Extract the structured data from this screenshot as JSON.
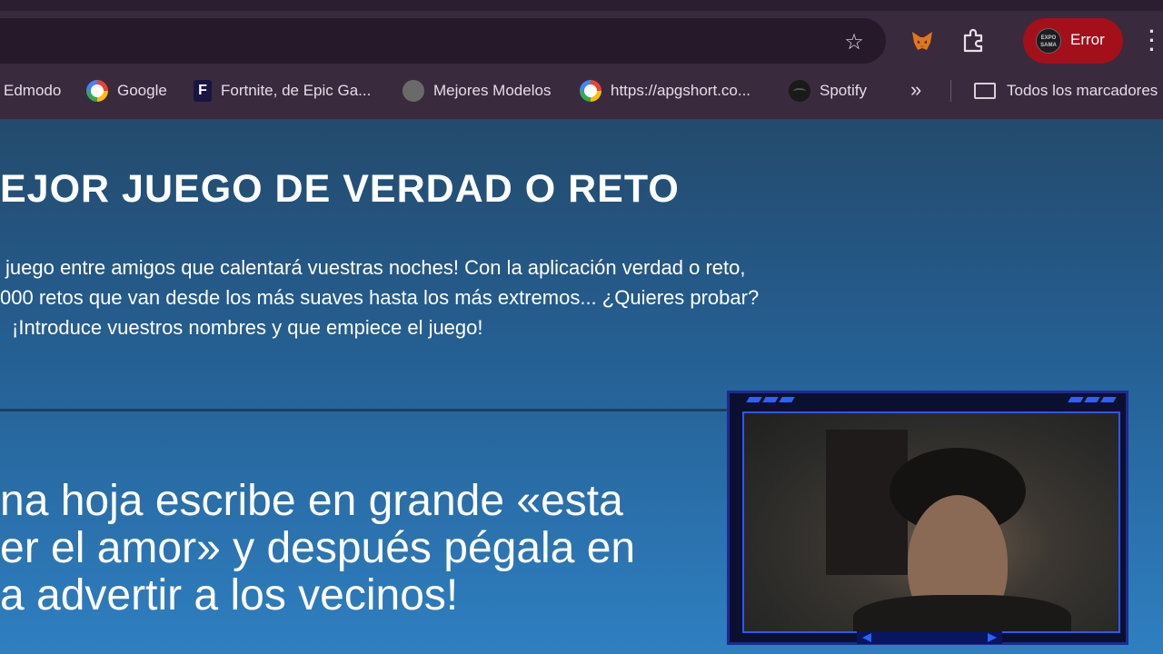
{
  "browser": {
    "profile_label": "Error",
    "avatar_text": "EXPO SAMA",
    "bookmarks": [
      {
        "label": "Edmodo",
        "icon": "edmodo-icon"
      },
      {
        "label": "Google",
        "icon": "google-icon"
      },
      {
        "label": "Fortnite, de Epic Ga...",
        "icon": "fortnite-icon"
      },
      {
        "label": "Mejores Modelos",
        "icon": "bear-icon"
      },
      {
        "label": "https://apgshort.co...",
        "icon": "google-icon"
      },
      {
        "label": "Spotify",
        "icon": "spotify-icon"
      }
    ],
    "more_bookmarks": "»",
    "all_bookmarks": "Todos los marcadores"
  },
  "page": {
    "title": "EJOR JUEGO DE VERDAD O RETO",
    "intro_lines": [
      "juego entre amigos que calentará vuestras noches! Con la aplicación verdad o reto,",
      "000 retos que van desde los más suaves hasta los más extremos... ¿Quieres probar?",
      "¡Introduce vuestros nombres y que empiece el juego!"
    ],
    "dare_lines": [
      "na hoja escribe en grande «esta",
      "er el amor» y después pégala en",
      "a advertir a los vecinos!"
    ]
  },
  "colors": {
    "toolbar": "#3a2a3d",
    "profile_button": "#a3101a",
    "page_top": "#244a6c",
    "page_bottom": "#2f7fc1",
    "cam_accent": "#2b62ff"
  }
}
